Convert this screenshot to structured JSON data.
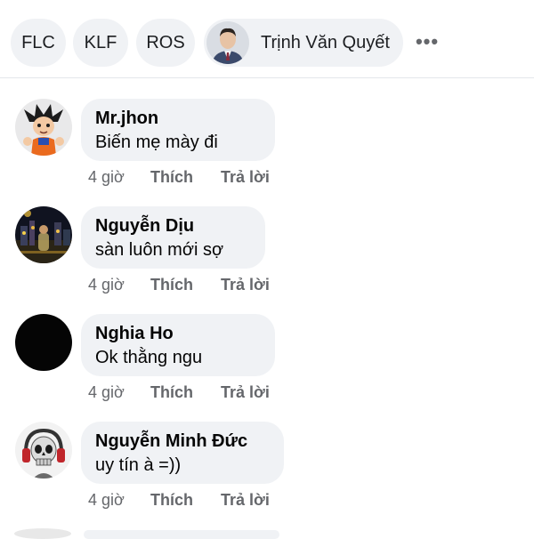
{
  "filter_chips": [
    {
      "label": "FLC"
    },
    {
      "label": "KLF"
    },
    {
      "label": "ROS"
    }
  ],
  "tagged_user": {
    "name": "Trịnh Văn Quyết",
    "icon": "person-avatar"
  },
  "more_label": "•••",
  "comments": [
    {
      "author": "Mr.jhon",
      "text": "Biến mẹ mày đi",
      "time": "4 giờ",
      "like": "Thích",
      "reply": "Trả lời",
      "avatar": "cartoon-avatar"
    },
    {
      "author": "Nguyễn Dịu",
      "text": "sàn luôn mới sợ",
      "time": "4 giờ",
      "like": "Thích",
      "reply": "Trả lời",
      "avatar": "city-night-avatar"
    },
    {
      "author": "Nghia Ho",
      "text": "Ok thằng ngu",
      "time": "4 giờ",
      "like": "Thích",
      "reply": "Trả lời",
      "avatar": "black-avatar"
    },
    {
      "author": "Nguyễn Minh Đức",
      "text": "uy tín à =))",
      "time": "4 giờ",
      "like": "Thích",
      "reply": "Trả lời",
      "avatar": "skull-headphones-avatar"
    }
  ]
}
